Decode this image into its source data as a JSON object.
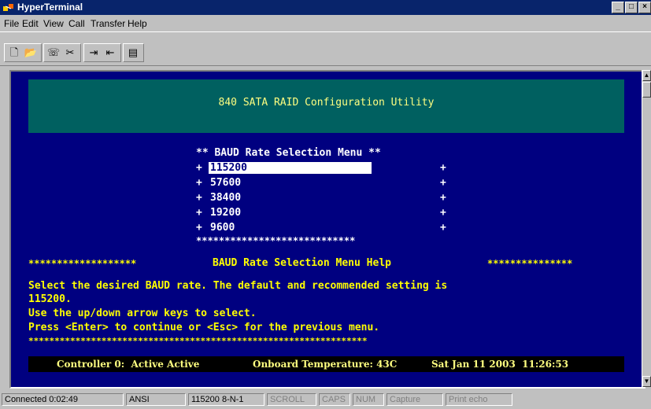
{
  "window": {
    "title": "HyperTerminal",
    "minimize_glyph": "_",
    "maximize_glyph": "□",
    "close_glyph": "×"
  },
  "menu": {
    "items": [
      "File",
      "Edit",
      "View",
      "Call",
      "Transfer",
      "Help"
    ]
  },
  "toolbar": {
    "buttons": [
      {
        "icon": "new-icon",
        "glyph": "🗋"
      },
      {
        "icon": "open-icon",
        "glyph": "📂"
      },
      {
        "icon": "connect-icon",
        "glyph": "☏"
      },
      {
        "icon": "disconnect-icon",
        "glyph": "✂"
      },
      {
        "icon": "send-icon",
        "glyph": "⇥"
      },
      {
        "icon": "receive-icon",
        "glyph": "⇤"
      },
      {
        "icon": "properties-icon",
        "glyph": "▤"
      }
    ]
  },
  "terminal": {
    "banner_title": "840 SATA RAID Configuration Utility",
    "menu_title": "** BAUD Rate Selection Menu **",
    "options": [
      "115200",
      "57600",
      "38400",
      "19200",
      "9600"
    ],
    "selected_option": "115200",
    "menu_border": "****************************",
    "help_stars_left": "*******************",
    "help_title": "BAUD Rate Selection Menu Help",
    "help_stars_right": "***************",
    "help_line1": "Select the desired BAUD rate. The default and recommended setting is",
    "help_line2": "115200.",
    "help_line3": "Use the up/down arrow keys to select.",
    "help_line4": "Press <Enter> to continue or <Esc> for the previous menu.",
    "help_border": "*****************************************************************",
    "status": {
      "controller": "Controller 0:  Active Active",
      "temperature": "Onboard Temperature: 43C",
      "datetime": "Sat Jan 11 2003  11:26:53"
    }
  },
  "statusbar": {
    "connected": "Connected 0:02:49",
    "emulation": "ANSI",
    "settings": "115200 8-N-1",
    "scroll": "SCROLL",
    "caps": "CAPS",
    "num": "NUM",
    "capture": "Capture",
    "print_echo": "Print echo"
  }
}
